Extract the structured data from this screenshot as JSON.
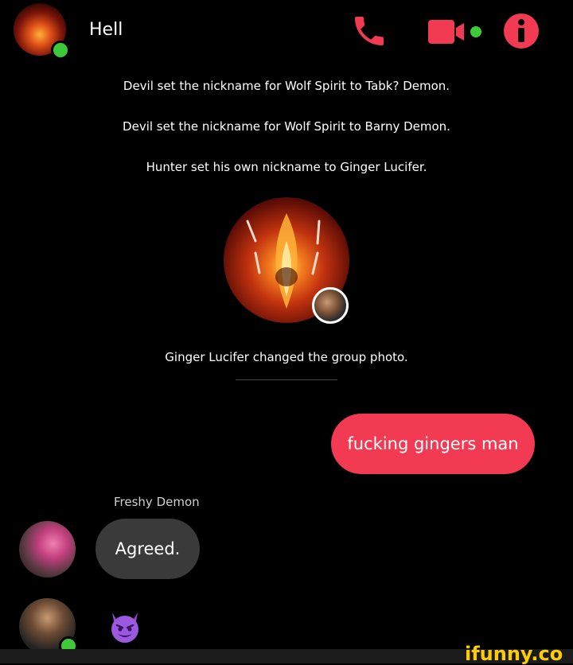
{
  "header": {
    "title": "Hell",
    "call_icon": "phone-icon",
    "video_icon": "video-camera-icon",
    "info_icon": "info-icon"
  },
  "system_messages": [
    "Devil set the nickname for Wolf Spirit to Tabk? Demon.",
    "Devil set the nickname for Wolf Spirit to Barny Demon.",
    "Hunter set his own nickname to Ginger Lucifer."
  ],
  "group_photo_event": {
    "text": "Ginger Lucifer changed the group photo."
  },
  "messages": [
    {
      "direction": "outgoing",
      "text": "fucking gingers man"
    },
    {
      "direction": "incoming",
      "sender": "Freshy Demon",
      "text": "Agreed."
    },
    {
      "direction": "incoming",
      "emoji": "smiling-devil"
    }
  ],
  "watermark": "ifunny.co",
  "colors": {
    "accent": "#f23a52",
    "background": "#000000",
    "incoming_bubble": "#3a3a3a",
    "online": "#3ec93a"
  }
}
